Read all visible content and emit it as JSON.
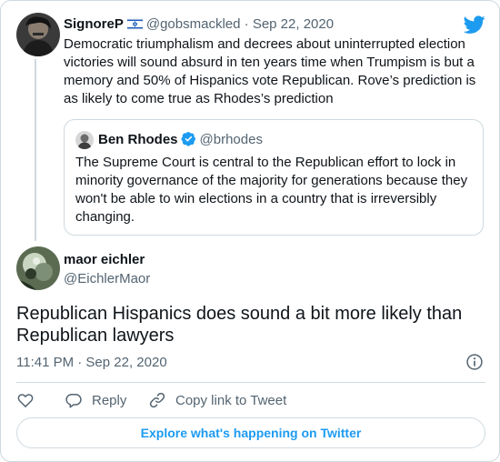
{
  "colors": {
    "twitter_blue": "#1d9bf0",
    "text": "#0f1419",
    "muted": "#536471",
    "border": "#cfd9de"
  },
  "parent_tweet": {
    "name": "SignoreP",
    "flag_icon": "israel-flag-icon",
    "handle": "@gobsmackled",
    "separator": "·",
    "date": "Sep 22, 2020",
    "text": "Democratic triumphalism and decrees about uninterrupted election victories will sound absurd in ten years time when Trumpism is but a memory and 50% of Hispanics vote Republican. Rove’s prediction is as likely to come true as Rhodes’s prediction"
  },
  "quoted_tweet": {
    "name": "Ben Rhodes",
    "verified_icon": "verified-badge-icon",
    "handle": "@brhodes",
    "text": "The Supreme Court is central to the Republican effort to lock in minority governance of the majority for generations because they won't be able to win elections in a country that is irreversibly changing."
  },
  "main_tweet": {
    "name": "maor eichler",
    "handle": "@EichlerMaor",
    "text": "Republican Hispanics does sound a bit more likely than Republican lawyers",
    "timestamp": "11:41 PM · Sep 22, 2020"
  },
  "actions": {
    "like_icon": "heart-icon",
    "reply_icon": "reply-icon",
    "reply_label": "Reply",
    "copy_icon": "link-icon",
    "copy_label": "Copy link to Tweet"
  },
  "explore_label": "Explore what's happening on Twitter"
}
